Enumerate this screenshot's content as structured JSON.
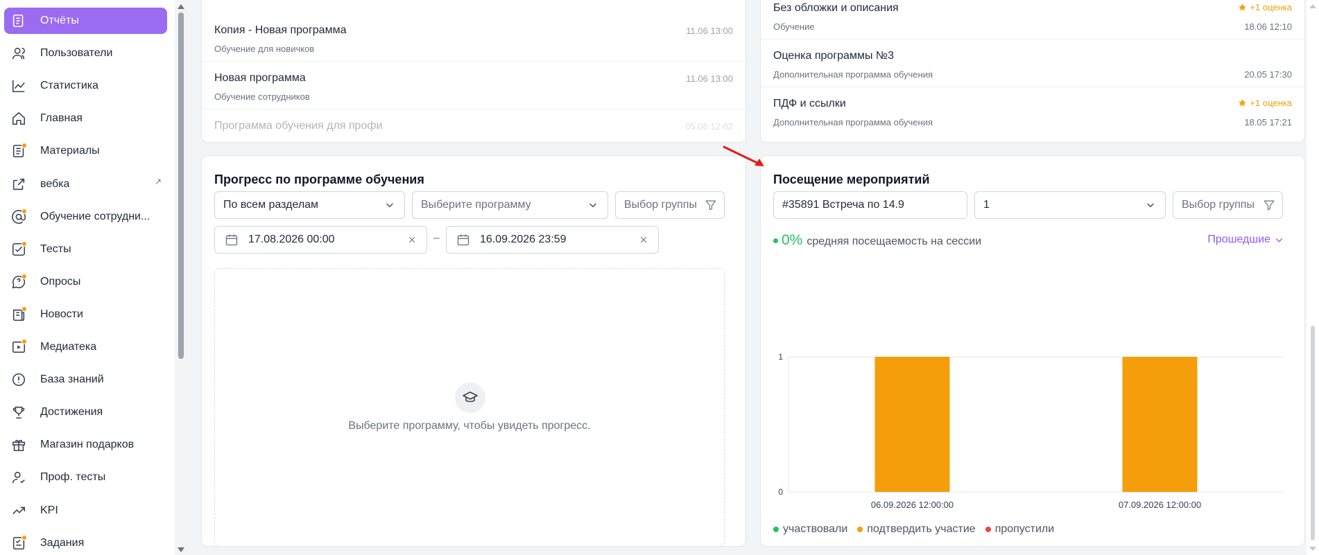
{
  "sidebar": {
    "items": [
      {
        "label": "Отчёты",
        "icon": "reports-icon",
        "active": true,
        "dot": false
      },
      {
        "label": "Пользователи",
        "icon": "users-icon",
        "active": false,
        "dot": false
      },
      {
        "label": "Статистика",
        "icon": "chart-line-icon",
        "active": false,
        "dot": false
      },
      {
        "label": "Главная",
        "icon": "home-icon",
        "active": false,
        "dot": false
      },
      {
        "label": "Материалы",
        "icon": "materials-icon",
        "active": false,
        "dot": true
      },
      {
        "label": "вебка",
        "icon": "external-link-icon",
        "active": false,
        "dot": false,
        "external": "↗"
      },
      {
        "label": "Обучение сотрудни...",
        "icon": "at-sign-icon",
        "active": false,
        "dot": true
      },
      {
        "label": "Тесты",
        "icon": "checklist-icon",
        "active": false,
        "dot": true
      },
      {
        "label": "Опросы",
        "icon": "question-bubble-icon",
        "active": false,
        "dot": true
      },
      {
        "label": "Новости",
        "icon": "news-icon",
        "active": false,
        "dot": true
      },
      {
        "label": "Медиатека",
        "icon": "media-icon",
        "active": false,
        "dot": true
      },
      {
        "label": "База знаний",
        "icon": "info-circle-icon",
        "active": false,
        "dot": false
      },
      {
        "label": "Достижения",
        "icon": "trophy-icon",
        "active": false,
        "dot": false
      },
      {
        "label": "Магазин подарков",
        "icon": "gift-icon",
        "active": false,
        "dot": false
      },
      {
        "label": "Проф. тесты",
        "icon": "user-check-icon",
        "active": false,
        "dot": false
      },
      {
        "label": "KPI",
        "icon": "trend-up-icon",
        "active": false,
        "dot": false
      },
      {
        "label": "Задания",
        "icon": "tasks-icon",
        "active": false,
        "dot": true
      }
    ]
  },
  "programs_list": {
    "rows": [
      {
        "title": "Копия - Новая программа",
        "subtitle": "Обучение для новичков",
        "time": "11.06 13:00"
      },
      {
        "title": "Новая программа",
        "subtitle": "Обучение сотрудников",
        "time": "11.06 13:00"
      },
      {
        "title": "Программа обучения для профи",
        "subtitle": "",
        "time": "05.06 12:02"
      }
    ]
  },
  "reviews_list": {
    "rows": [
      {
        "title": "Без обложки и описания",
        "subtitle": "Обучение",
        "badge": "+1 оценка",
        "time": "18.06 12:10"
      },
      {
        "title": "Оценка программы №3",
        "subtitle": "Дополнительная программа обучения",
        "badge": "",
        "time": "20.05 17:30"
      },
      {
        "title": "ПДФ и ссылки",
        "subtitle": "Дополнительная программа обучения",
        "badge": "+1 оценка",
        "time": "18.05 17:21"
      }
    ]
  },
  "progress": {
    "title": "Прогресс по программе обучения",
    "sections_select": "По всем разделам",
    "program_select_placeholder": "Выберите программу",
    "group_placeholder": "Выбор группы",
    "date_from": "17.08.2026 00:00",
    "date_to": "16.09.2026 23:59",
    "date_separator": "–",
    "empty_text": "Выберите программу, чтобы увидеть прогресс."
  },
  "attendance": {
    "title": "Посещение мероприятий",
    "event_select": "#35891 Встреча по 14.9",
    "session_select": "1",
    "group_placeholder": "Выбор группы",
    "percent": "0%",
    "summary_text": "средняя посещаемость на сессии",
    "period_link": "Прошедшие"
  },
  "colors": {
    "accent": "#9b6bf2",
    "participated": "#22c55e",
    "confirm": "#f59e0b",
    "missed": "#ef4444"
  },
  "chart_data": {
    "type": "bar",
    "categories": [
      "06.09.2026 12:00:00",
      "07.09.2026 12:00:00"
    ],
    "series": [
      {
        "name": "участвовали",
        "values": [
          0,
          0
        ],
        "color": "#22c55e"
      },
      {
        "name": "подтвердить участие",
        "values": [
          1,
          1
        ],
        "color": "#f59e0b"
      },
      {
        "name": "пропустили",
        "values": [
          0,
          0
        ],
        "color": "#ef4444"
      }
    ],
    "yticks": [
      0,
      1
    ],
    "ylim": [
      0,
      1
    ],
    "legend": "bottom-left",
    "grid": true
  }
}
